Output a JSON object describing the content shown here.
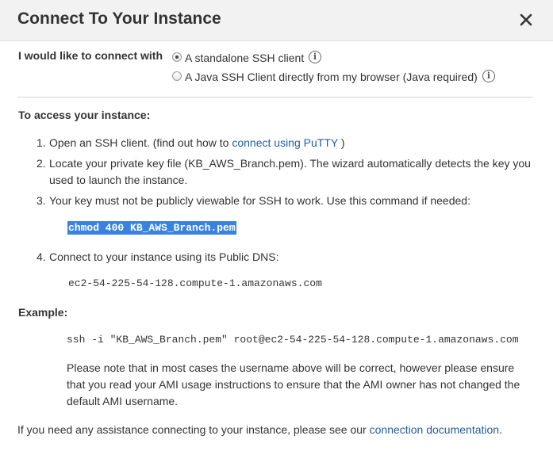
{
  "dialog": {
    "title": "Connect To Your Instance",
    "close_icon": "close-icon"
  },
  "connect_with": {
    "label": "I would like to connect with",
    "options": [
      {
        "label": "A standalone SSH client",
        "selected": true
      },
      {
        "label": "A Java SSH Client directly from my browser (Java required)",
        "selected": false
      }
    ],
    "info_glyph": "i"
  },
  "access": {
    "heading": "To access your instance:",
    "steps": [
      {
        "number": "1.",
        "text_before": "Open an SSH client. (find out how to",
        "link": "connect using PuTTY",
        "text_after": ")"
      },
      {
        "number": "2.",
        "line1": "Locate your private key file (KB_AWS_Branch.pem). The wizard automatically detects the key you",
        "line2": "used to launch the instance."
      },
      {
        "number": "3.",
        "text": "Your key must not be publicly viewable for SSH to work. Use this command if needed:"
      },
      {
        "number": "4.",
        "text": "Connect to your instance using its Public DNS:"
      }
    ],
    "chmod_command": "chmod 400 KB_AWS_Branch.pem",
    "public_dns": "ec2-54-225-54-128.compute-1.amazonaws.com"
  },
  "example": {
    "heading": "Example:",
    "command": "ssh -i \"KB_AWS_Branch.pem\" root@ec2-54-225-54-128.compute-1.amazonaws.com",
    "note_lines": [
      "Please note that in most cases the username above will be correct, however please ensure",
      "that you read your AMI usage instructions to ensure that the AMI owner has not changed the",
      "default AMI username."
    ]
  },
  "footer": {
    "text": "If you need any assistance connecting to your instance, please see our",
    "link": "connection documentation",
    "suffix": "."
  },
  "colors": {
    "link": "#1f5e9e",
    "highlight": "#3a82e0",
    "header_bg": "#f2f2f2"
  }
}
